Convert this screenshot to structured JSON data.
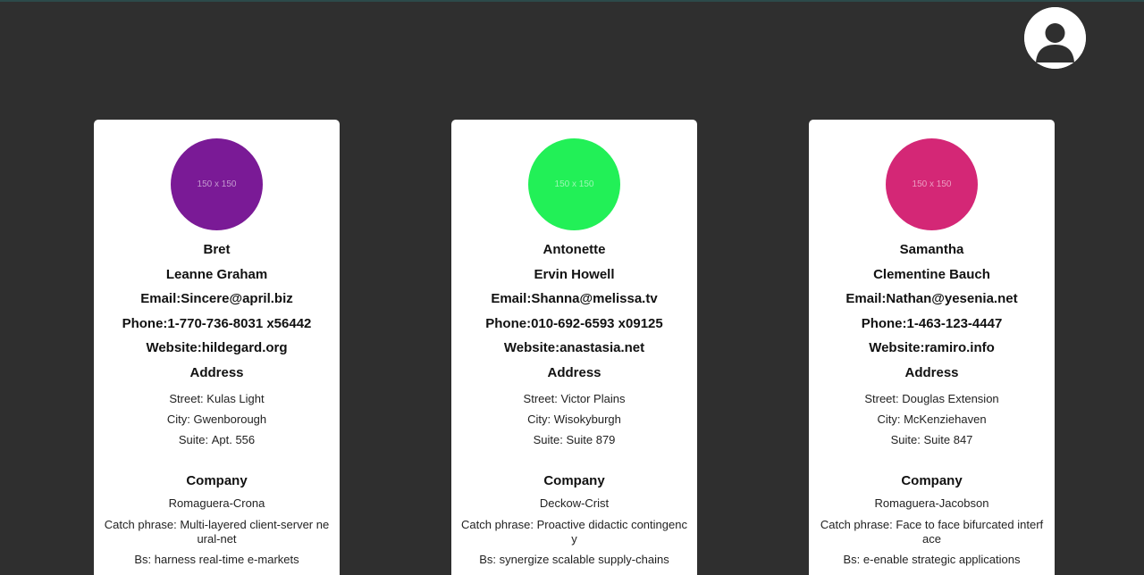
{
  "header": {
    "avatar_icon": "user-avatar-icon"
  },
  "labels": {
    "email": "Email: ",
    "phone": "Phone: ",
    "website": "Website: ",
    "address": "Address",
    "street": "Street: ",
    "city": "City: ",
    "suite": "Suite: ",
    "company": "Company",
    "catch_phrase": "Catch phrase: ",
    "bs": "Bs: "
  },
  "users": [
    {
      "photo_text": "150 x 150",
      "photo_color": "#7a1a96",
      "username": "Bret",
      "name": "Leanne Graham",
      "email": "Sincere@april.biz",
      "phone": "1-770-736-8031 x56442",
      "website": "hildegard.org",
      "street": "Kulas Light",
      "city": "Gwenborough",
      "suite": "Apt. 556",
      "company_name": "Romaguera-Crona",
      "catch_phrase": "Multi-layered client-server neural-net",
      "bs": "harness real-time e-markets"
    },
    {
      "photo_text": "150 x 150",
      "photo_color": "#22f057",
      "username": "Antonette",
      "name": "Ervin Howell",
      "email": "Shanna@melissa.tv",
      "phone": "010-692-6593 x09125",
      "website": "anastasia.net",
      "street": "Victor Plains",
      "city": "Wisokyburgh",
      "suite": "Suite 879",
      "company_name": "Deckow-Crist",
      "catch_phrase": "Proactive didactic contingency",
      "bs": "synergize scalable supply-chains"
    },
    {
      "photo_text": "150 x 150",
      "photo_color": "#d42776",
      "username": "Samantha",
      "name": "Clementine Bauch",
      "email": "Nathan@yesenia.net",
      "phone": "1-463-123-4447",
      "website": "ramiro.info",
      "street": "Douglas Extension",
      "city": "McKenziehaven",
      "suite": "Suite 847",
      "company_name": "Romaguera-Jacobson",
      "catch_phrase": "Face to face bifurcated interface",
      "bs": "e-enable strategic applications"
    }
  ]
}
